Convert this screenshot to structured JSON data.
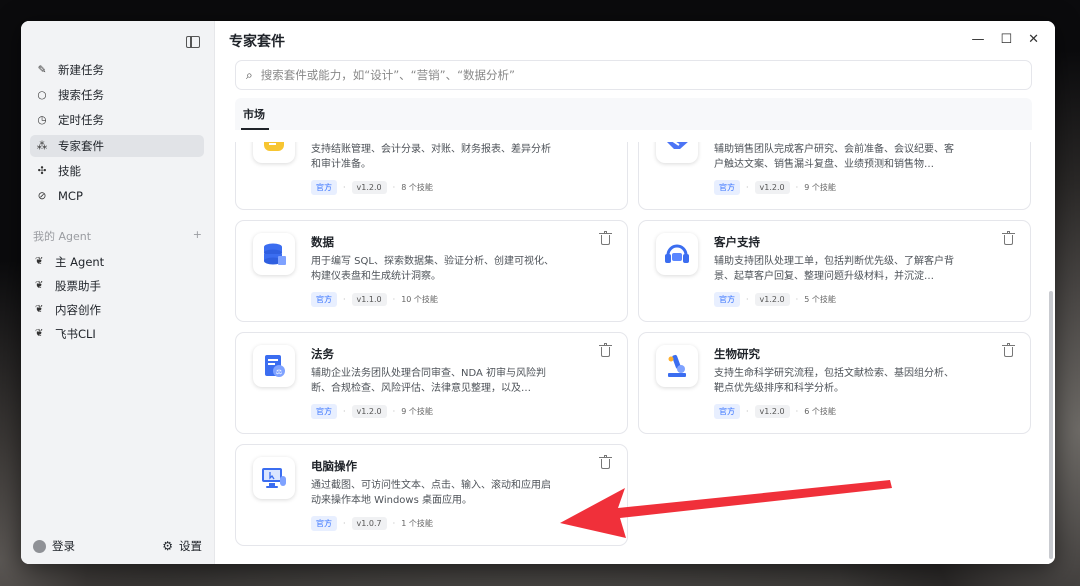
{
  "window": {
    "title": "专家套件"
  },
  "sidebar": {
    "items": [
      {
        "icon": "edit-icon",
        "glyph": "✎",
        "label": "新建任务"
      },
      {
        "icon": "search-icon",
        "glyph": "○",
        "label": "搜索任务"
      },
      {
        "icon": "clock-icon",
        "glyph": "◷",
        "label": "定时任务"
      },
      {
        "icon": "grid-icon",
        "glyph": "⁂",
        "label": "专家套件",
        "active": true
      },
      {
        "icon": "puzzle-icon",
        "glyph": "✣",
        "label": "技能"
      },
      {
        "icon": "link-icon",
        "glyph": "⊘",
        "label": "MCP"
      }
    ],
    "agents_header": "我的 Agent",
    "agents_add": "+",
    "agents": [
      {
        "icon": "agent-icon",
        "label": "主 Agent"
      },
      {
        "icon": "agent-icon",
        "label": "股票助手"
      },
      {
        "icon": "agent-icon",
        "label": "内容创作"
      },
      {
        "icon": "agent-icon",
        "label": "飞书CLI"
      }
    ],
    "footer": {
      "login": "登录",
      "settings": "设置"
    }
  },
  "search": {
    "placeholder": "搜索套件或能力，如“设计”、“营销”、“数据分析”"
  },
  "tabs": [
    {
      "label": "市场",
      "active": true
    }
  ],
  "cards": [
    {
      "name": "",
      "desc": "支持结账管理、会计分录、对账、财务报表、差异分析和审计准备。",
      "official": "官方",
      "version": "v1.2.0",
      "skills": "8 个技能",
      "icon": "finance-icon",
      "partial": true
    },
    {
      "name": "",
      "desc": "辅助销售团队完成客户研究、会前准备、会议纪要、客户触达文案、销售漏斗复盘、业绩预测和销售物…",
      "official": "官方",
      "version": "v1.2.0",
      "skills": "9 个技能",
      "icon": "handshake-icon",
      "partial": true
    },
    {
      "name": "数据",
      "desc": "用于编写 SQL、探索数据集、验证分析、创建可视化、构建仪表盘和生成统计洞察。",
      "official": "官方",
      "version": "v1.1.0",
      "skills": "10 个技能",
      "icon": "database-icon"
    },
    {
      "name": "客户支持",
      "desc": "辅助支持团队处理工单，包括判断优先级、了解客户背景、起草客户回复、整理问题升级材料，并沉淀…",
      "official": "官方",
      "version": "v1.2.0",
      "skills": "5 个技能",
      "icon": "headset-icon"
    },
    {
      "name": "法务",
      "desc": "辅助企业法务团队处理合同审查、NDA 初审与风险判断、合规检查、风险评估、法律意见整理，以及…",
      "official": "官方",
      "version": "v1.2.0",
      "skills": "9 个技能",
      "icon": "legal-icon"
    },
    {
      "name": "生物研究",
      "desc": "支持生命科学研究流程，包括文献检索、基因组分析、靶点优先级排序和科学分析。",
      "official": "官方",
      "version": "v1.2.0",
      "skills": "6 个技能",
      "icon": "microscope-icon"
    },
    {
      "name": "电脑操作",
      "desc": "通过截图、可访问性文本、点击、输入、滚动和应用启动来操作本地 Windows 桌面应用。",
      "official": "官方",
      "version": "v1.0.7",
      "skills": "1 个技能",
      "icon": "computer-icon"
    }
  ],
  "colors": {
    "accent": "#3370ff",
    "arrow": "#f0303a"
  }
}
